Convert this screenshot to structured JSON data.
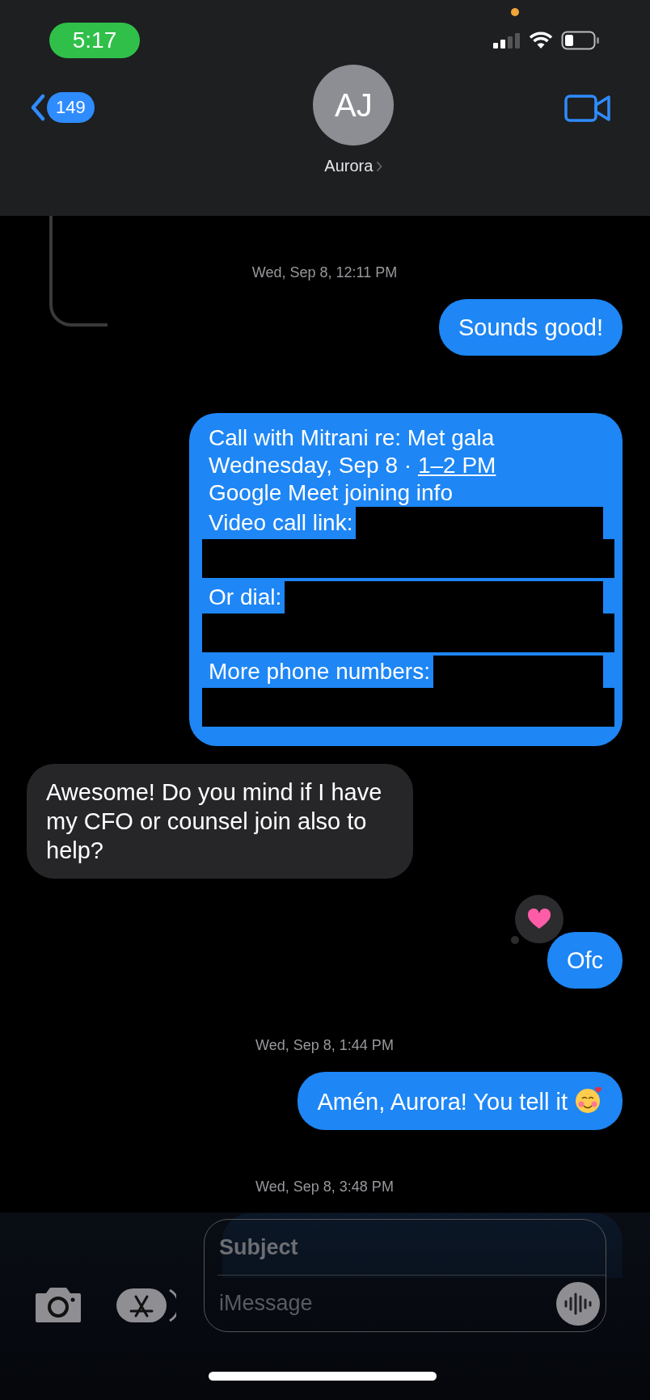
{
  "status_bar": {
    "time": "5:17"
  },
  "header": {
    "back_count": "149",
    "avatar_initials": "AJ",
    "contact_name": "Aurora"
  },
  "messages": [
    {
      "kind": "timestamp",
      "text": "Wed, Sep 8, 12:11 PM"
    },
    {
      "kind": "sent",
      "text": "Sounds good!"
    },
    {
      "kind": "event",
      "lines": [
        {
          "kind": "text",
          "text": "Call with Mitrani re: Met gala"
        },
        {
          "kind": "text",
          "text": "Wednesday, Sep 8 · ",
          "link": "1–2 PM"
        },
        {
          "kind": "text",
          "text": "Google Meet joining info"
        },
        {
          "kind": "text",
          "text": "Video call link:",
          "redacted": true
        },
        {
          "kind": "redaction"
        },
        {
          "kind": "text",
          "text": "Or dial:",
          "redacted": true
        },
        {
          "kind": "redaction"
        },
        {
          "kind": "text",
          "text": "More phone numbers:",
          "redacted": true
        },
        {
          "kind": "redaction"
        }
      ]
    },
    {
      "kind": "received",
      "text": "Awesome! Do you mind if I have my CFO or counsel join also to help?"
    },
    {
      "kind": "sent",
      "text": "Ofc",
      "reaction": {
        "kind": "heart"
      }
    },
    {
      "kind": "timestamp",
      "text": "Wed, Sep 8, 1:44 PM"
    },
    {
      "kind": "sent",
      "text": "Amén, Aurora! You tell it",
      "emoji": {
        "kind": "smiling-hearts"
      }
    },
    {
      "kind": "timestamp",
      "text": "Wed, Sep 8, 3:48 PM"
    },
    {
      "kind": "sent_partial"
    }
  ],
  "composer": {
    "subject_placeholder": "Subject",
    "message_placeholder": "iMessage"
  }
}
